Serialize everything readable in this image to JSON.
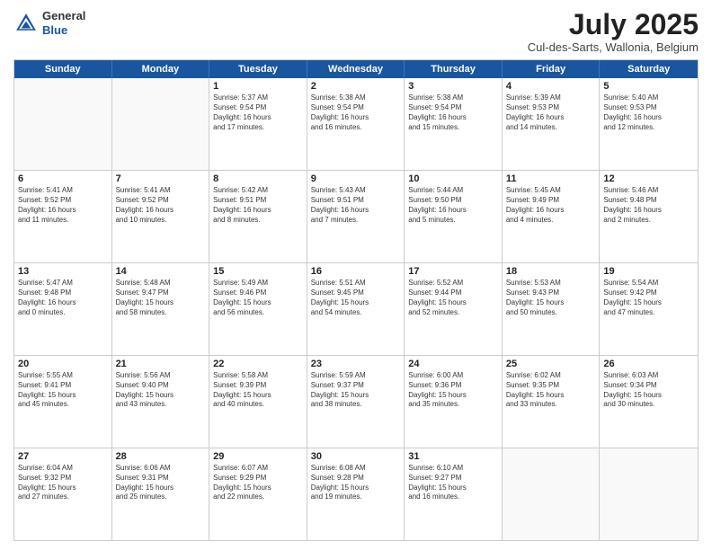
{
  "header": {
    "logo_line1": "General",
    "logo_line2": "Blue",
    "month": "July 2025",
    "location": "Cul-des-Sarts, Wallonia, Belgium"
  },
  "weekdays": [
    "Sunday",
    "Monday",
    "Tuesday",
    "Wednesday",
    "Thursday",
    "Friday",
    "Saturday"
  ],
  "weeks": [
    [
      {
        "day": "",
        "content": ""
      },
      {
        "day": "",
        "content": ""
      },
      {
        "day": "1",
        "content": "Sunrise: 5:37 AM\nSunset: 9:54 PM\nDaylight: 16 hours\nand 17 minutes."
      },
      {
        "day": "2",
        "content": "Sunrise: 5:38 AM\nSunset: 9:54 PM\nDaylight: 16 hours\nand 16 minutes."
      },
      {
        "day": "3",
        "content": "Sunrise: 5:38 AM\nSunset: 9:54 PM\nDaylight: 16 hours\nand 15 minutes."
      },
      {
        "day": "4",
        "content": "Sunrise: 5:39 AM\nSunset: 9:53 PM\nDaylight: 16 hours\nand 14 minutes."
      },
      {
        "day": "5",
        "content": "Sunrise: 5:40 AM\nSunset: 9:53 PM\nDaylight: 16 hours\nand 12 minutes."
      }
    ],
    [
      {
        "day": "6",
        "content": "Sunrise: 5:41 AM\nSunset: 9:52 PM\nDaylight: 16 hours\nand 11 minutes."
      },
      {
        "day": "7",
        "content": "Sunrise: 5:41 AM\nSunset: 9:52 PM\nDaylight: 16 hours\nand 10 minutes."
      },
      {
        "day": "8",
        "content": "Sunrise: 5:42 AM\nSunset: 9:51 PM\nDaylight: 16 hours\nand 8 minutes."
      },
      {
        "day": "9",
        "content": "Sunrise: 5:43 AM\nSunset: 9:51 PM\nDaylight: 16 hours\nand 7 minutes."
      },
      {
        "day": "10",
        "content": "Sunrise: 5:44 AM\nSunset: 9:50 PM\nDaylight: 16 hours\nand 5 minutes."
      },
      {
        "day": "11",
        "content": "Sunrise: 5:45 AM\nSunset: 9:49 PM\nDaylight: 16 hours\nand 4 minutes."
      },
      {
        "day": "12",
        "content": "Sunrise: 5:46 AM\nSunset: 9:48 PM\nDaylight: 16 hours\nand 2 minutes."
      }
    ],
    [
      {
        "day": "13",
        "content": "Sunrise: 5:47 AM\nSunset: 9:48 PM\nDaylight: 16 hours\nand 0 minutes."
      },
      {
        "day": "14",
        "content": "Sunrise: 5:48 AM\nSunset: 9:47 PM\nDaylight: 15 hours\nand 58 minutes."
      },
      {
        "day": "15",
        "content": "Sunrise: 5:49 AM\nSunset: 9:46 PM\nDaylight: 15 hours\nand 56 minutes."
      },
      {
        "day": "16",
        "content": "Sunrise: 5:51 AM\nSunset: 9:45 PM\nDaylight: 15 hours\nand 54 minutes."
      },
      {
        "day": "17",
        "content": "Sunrise: 5:52 AM\nSunset: 9:44 PM\nDaylight: 15 hours\nand 52 minutes."
      },
      {
        "day": "18",
        "content": "Sunrise: 5:53 AM\nSunset: 9:43 PM\nDaylight: 15 hours\nand 50 minutes."
      },
      {
        "day": "19",
        "content": "Sunrise: 5:54 AM\nSunset: 9:42 PM\nDaylight: 15 hours\nand 47 minutes."
      }
    ],
    [
      {
        "day": "20",
        "content": "Sunrise: 5:55 AM\nSunset: 9:41 PM\nDaylight: 15 hours\nand 45 minutes."
      },
      {
        "day": "21",
        "content": "Sunrise: 5:56 AM\nSunset: 9:40 PM\nDaylight: 15 hours\nand 43 minutes."
      },
      {
        "day": "22",
        "content": "Sunrise: 5:58 AM\nSunset: 9:39 PM\nDaylight: 15 hours\nand 40 minutes."
      },
      {
        "day": "23",
        "content": "Sunrise: 5:59 AM\nSunset: 9:37 PM\nDaylight: 15 hours\nand 38 minutes."
      },
      {
        "day": "24",
        "content": "Sunrise: 6:00 AM\nSunset: 9:36 PM\nDaylight: 15 hours\nand 35 minutes."
      },
      {
        "day": "25",
        "content": "Sunrise: 6:02 AM\nSunset: 9:35 PM\nDaylight: 15 hours\nand 33 minutes."
      },
      {
        "day": "26",
        "content": "Sunrise: 6:03 AM\nSunset: 9:34 PM\nDaylight: 15 hours\nand 30 minutes."
      }
    ],
    [
      {
        "day": "27",
        "content": "Sunrise: 6:04 AM\nSunset: 9:32 PM\nDaylight: 15 hours\nand 27 minutes."
      },
      {
        "day": "28",
        "content": "Sunrise: 6:06 AM\nSunset: 9:31 PM\nDaylight: 15 hours\nand 25 minutes."
      },
      {
        "day": "29",
        "content": "Sunrise: 6:07 AM\nSunset: 9:29 PM\nDaylight: 15 hours\nand 22 minutes."
      },
      {
        "day": "30",
        "content": "Sunrise: 6:08 AM\nSunset: 9:28 PM\nDaylight: 15 hours\nand 19 minutes."
      },
      {
        "day": "31",
        "content": "Sunrise: 6:10 AM\nSunset: 9:27 PM\nDaylight: 15 hours\nand 16 minutes."
      },
      {
        "day": "",
        "content": ""
      },
      {
        "day": "",
        "content": ""
      }
    ]
  ]
}
